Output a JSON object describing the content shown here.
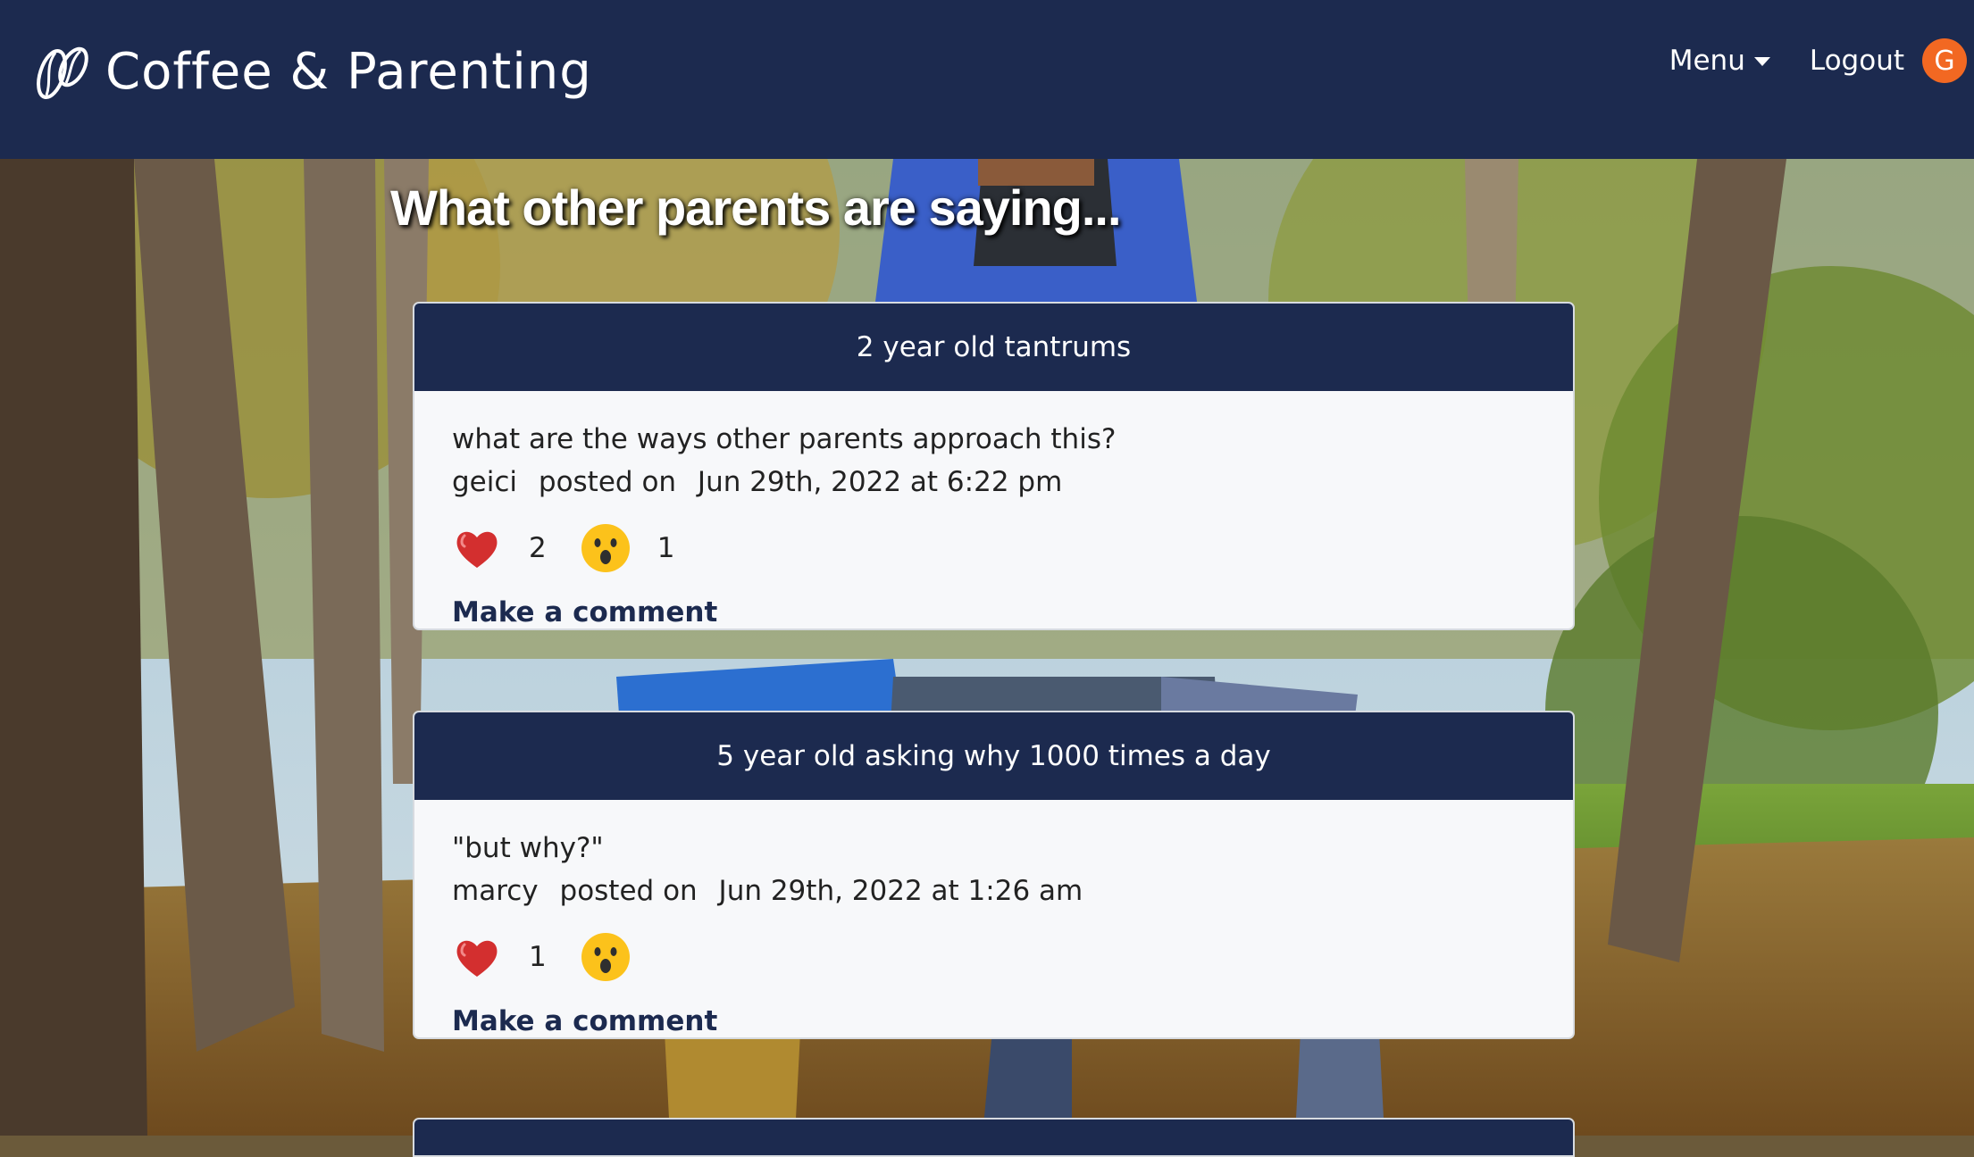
{
  "navbar": {
    "brand": "Coffee & Parenting",
    "menu_label": "Menu",
    "logout_label": "Logout",
    "avatar_initial": "G",
    "avatar_color": "#f26822",
    "bg_color": "#1c2a4f"
  },
  "page": {
    "heading": "What other parents are saying..."
  },
  "posts": [
    {
      "title": "2 year old tantrums",
      "body": "what are the ways other parents approach this?",
      "author": "geici",
      "posted_label": "posted on",
      "date": "Jun 29th, 2022 at 6:22 pm",
      "reactions": [
        {
          "icon": "heart-icon",
          "count": "2"
        },
        {
          "icon": "surprised-face-icon",
          "count": "1"
        }
      ],
      "comment_label": "Make a comment"
    },
    {
      "title": "5 year old asking why 1000 times a day",
      "body": "\"but why?\"",
      "author": "marcy",
      "posted_label": "posted on",
      "date": "Jun 29th, 2022 at 1:26 am",
      "reactions": [
        {
          "icon": "heart-icon",
          "count": "1"
        },
        {
          "icon": "surprised-face-icon",
          "count": ""
        }
      ],
      "comment_label": "Make a comment"
    }
  ]
}
